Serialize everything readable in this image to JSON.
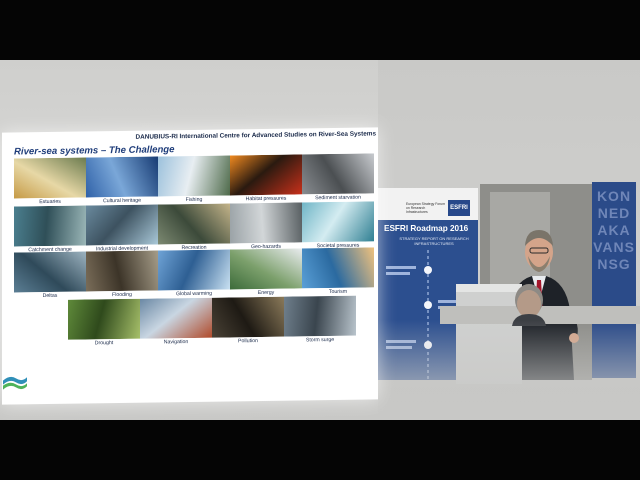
{
  "slide": {
    "header": "DANUBIUS-RI International Centre for Advanced Studies on River-Sea Systems",
    "title": "River-sea systems – The Challenge",
    "tiles": [
      {
        "label": "Estuaries",
        "colors": [
          "#c69a45",
          "#6b7b4f",
          "#e7d8a6"
        ]
      },
      {
        "label": "Cultural heritage",
        "colors": [
          "#2f61a8",
          "#173b73",
          "#7aa7d8"
        ]
      },
      {
        "label": "Fishing",
        "colors": [
          "#9cc1dc",
          "#4e6a4a",
          "#e8eef2"
        ]
      },
      {
        "label": "Habitat pressures",
        "colors": [
          "#f08a20",
          "#c8301a",
          "#2a1a10"
        ]
      },
      {
        "label": "Sediment starvation",
        "colors": [
          "#8a8e92",
          "#c8cbcf",
          "#4b4f52"
        ]
      },
      {
        "label": "Catchment change",
        "colors": [
          "#4b7f8f",
          "#9bb7b8",
          "#2f4f58"
        ]
      },
      {
        "label": "Industrial development",
        "colors": [
          "#6a8a9e",
          "#a9c8d8",
          "#3d5260"
        ]
      },
      {
        "label": "Recreation",
        "colors": [
          "#7d8a72",
          "#c4b48a",
          "#3c4a3a"
        ]
      },
      {
        "label": "Geo-hazards",
        "colors": [
          "#9aa2a6",
          "#585f62",
          "#d2d6d8"
        ]
      },
      {
        "label": "Societal pressures",
        "colors": [
          "#6fb5c6",
          "#2f7f92",
          "#d4ecf1"
        ]
      },
      {
        "label": "Deltas",
        "colors": [
          "#5c7f95",
          "#9db3c0",
          "#2f4a5a"
        ]
      },
      {
        "label": "Flooding",
        "colors": [
          "#7b6e5a",
          "#a59c88",
          "#3c3428"
        ]
      },
      {
        "label": "Global warming",
        "colors": [
          "#6fa3d6",
          "#c9e1f2",
          "#2e5f93"
        ]
      },
      {
        "label": "Energy",
        "colors": [
          "#3c6b3a",
          "#e9ecef",
          "#7ca06c"
        ]
      },
      {
        "label": "Tourism",
        "colors": [
          "#5aa0d8",
          "#f1c27d",
          "#2b6aa0"
        ]
      },
      {
        "label": "Drought",
        "colors": [
          "#5f8a3a",
          "#a7c06a",
          "#2f4a1c"
        ]
      },
      {
        "label": "Navigation",
        "colors": [
          "#6a88a4",
          "#b04a2a",
          "#c9d6e2"
        ]
      },
      {
        "label": "Pollution",
        "colors": [
          "#4a4236",
          "#8b7a5a",
          "#1e1a14"
        ]
      },
      {
        "label": "Storm surge",
        "colors": [
          "#6f7f8c",
          "#b9c4cc",
          "#3a454e"
        ]
      }
    ]
  },
  "banner": {
    "title": "ESFRI Roadmap 2016",
    "subtitle": "STRATEGY REPORT ON RESEARCH INFRASTRUCTURES",
    "logo": "ESFRI",
    "small_text": "European Strategy Forum on Research Infrastructures"
  },
  "wall_panel": {
    "letters": "KON\nNED\nAKA\nVANS\nNSG"
  },
  "colors": {
    "slide_title": "#1f3d7a",
    "banner_blue": "#2c4f8f"
  }
}
